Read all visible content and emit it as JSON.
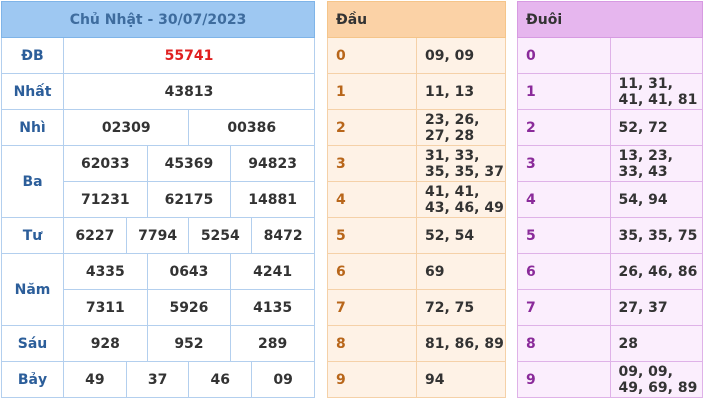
{
  "title": "Chủ Nhật - 30/07/2023",
  "prizes": {
    "db": {
      "label": "ĐB",
      "values": [
        "55741"
      ]
    },
    "nhat": {
      "label": "Nhất",
      "values": [
        "43813"
      ]
    },
    "nhi": {
      "label": "Nhì",
      "values": [
        "02309",
        "00386"
      ]
    },
    "ba": {
      "label": "Ba",
      "values": [
        "62033",
        "45369",
        "94823",
        "71231",
        "62175",
        "14881"
      ]
    },
    "tu": {
      "label": "Tư",
      "values": [
        "6227",
        "7794",
        "5254",
        "8472"
      ]
    },
    "nam": {
      "label": "Năm",
      "values": [
        "4335",
        "0643",
        "4241",
        "7311",
        "5926",
        "4135"
      ]
    },
    "sau": {
      "label": "Sáu",
      "values": [
        "928",
        "952",
        "289"
      ]
    },
    "bay": {
      "label": "Bảy",
      "values": [
        "49",
        "37",
        "46",
        "09"
      ]
    }
  },
  "dau": {
    "header": "Đầu",
    "rows": [
      {
        "k": "0",
        "v": "09, 09"
      },
      {
        "k": "1",
        "v": "11, 13"
      },
      {
        "k": "2",
        "v": "23, 26, 27, 28"
      },
      {
        "k": "3",
        "v": "31, 33, 35, 35, 37"
      },
      {
        "k": "4",
        "v": "41, 41, 43, 46, 49"
      },
      {
        "k": "5",
        "v": "52, 54"
      },
      {
        "k": "6",
        "v": "69"
      },
      {
        "k": "7",
        "v": "72, 75"
      },
      {
        "k": "8",
        "v": "81, 86, 89"
      },
      {
        "k": "9",
        "v": "94"
      }
    ]
  },
  "duoi": {
    "header": "Đuôi",
    "rows": [
      {
        "k": "0",
        "v": ""
      },
      {
        "k": "1",
        "v": "11, 31, 41, 41, 81"
      },
      {
        "k": "2",
        "v": "52, 72"
      },
      {
        "k": "3",
        "v": "13, 23, 33, 43"
      },
      {
        "k": "4",
        "v": "54, 94"
      },
      {
        "k": "5",
        "v": "35, 35, 75"
      },
      {
        "k": "6",
        "v": "26, 46, 86"
      },
      {
        "k": "7",
        "v": "27, 37"
      },
      {
        "k": "8",
        "v": "28"
      },
      {
        "k": "9",
        "v": "09, 09, 49, 69, 89"
      }
    ]
  },
  "colors": {
    "main_header": "#9ec8f2",
    "dau_header": "#fbd2a6",
    "duoi_header": "#e6b6ee",
    "special_prize": "#e02020"
  }
}
